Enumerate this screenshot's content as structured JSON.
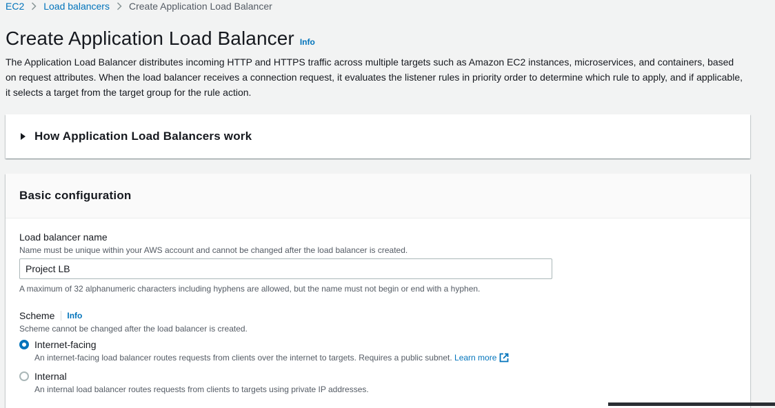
{
  "breadcrumb": {
    "items": [
      "EC2",
      "Load balancers"
    ],
    "current": "Create Application Load Balancer"
  },
  "header": {
    "title": "Create Application Load Balancer",
    "info": "Info",
    "description": "The Application Load Balancer distributes incoming HTTP and HTTPS traffic across multiple targets such as Amazon EC2 instances, microservices, and containers, based on request attributes. When the load balancer receives a connection request, it evaluates the listener rules in priority order to determine which rule to apply, and if applicable, it selects a target from the target group for the rule action."
  },
  "how_it_works": {
    "title": "How Application Load Balancers work"
  },
  "basic_config": {
    "title": "Basic configuration",
    "name_field": {
      "label": "Load balancer name",
      "description": "Name must be unique within your AWS account and cannot be changed after the load balancer is created.",
      "value": "Project LB",
      "constraint": "A maximum of 32 alphanumeric characters including hyphens are allowed, but the name must not begin or end with a hyphen."
    },
    "scheme": {
      "label": "Scheme",
      "info": "Info",
      "description": "Scheme cannot be changed after the load balancer is created.",
      "selected": "Internet-facing",
      "options": [
        {
          "label": "Internet-facing",
          "description": "An internet-facing load balancer routes requests from clients over the internet to targets. Requires a public subnet.",
          "link": "Learn more"
        },
        {
          "label": "Internal",
          "description": "An internal load balancer routes requests from clients to targets using private IP addresses."
        }
      ]
    }
  },
  "colors": {
    "link": "#0073bb",
    "background": "#f2f3f3",
    "text": "#16191f",
    "muted": "#545b64"
  }
}
